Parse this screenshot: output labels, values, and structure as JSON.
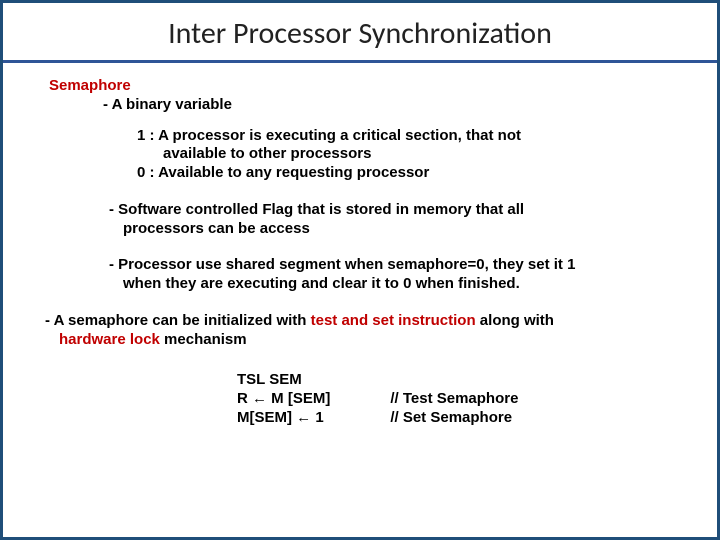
{
  "title": "Inter Processor Synchronization",
  "semaphore": {
    "heading": "Semaphore",
    "sub1": "- A binary variable",
    "b1a": "1 :  A processor is executing a critical section, that not",
    "b1b": "available to other processors",
    "b0": "0 :  Available to any requesting processor",
    "p1a": "- Software controlled Flag that is stored in memory that all",
    "p1b": "processors can be access",
    "p2a": "- Processor use shared segment when semaphore=0, they set it 1",
    "p2b": "when they are executing and clear it to 0 when finished.",
    "p3a_pre": "- A semaphore can be initialized with ",
    "p3a_red": "test and set instruction",
    "p3a_post": " along with",
    "p3b_red": "hardware lock",
    "p3b_post": " mechanism"
  },
  "tsl": {
    "l1": "TSL SEM",
    "l2a": "R ",
    "l2b": " M [SEM]",
    "l3a": "M[SEM] ",
    "l3b": " 1",
    "c1": "// Test Semaphore",
    "c2": "// Set Semaphore",
    "arrow": "←"
  }
}
